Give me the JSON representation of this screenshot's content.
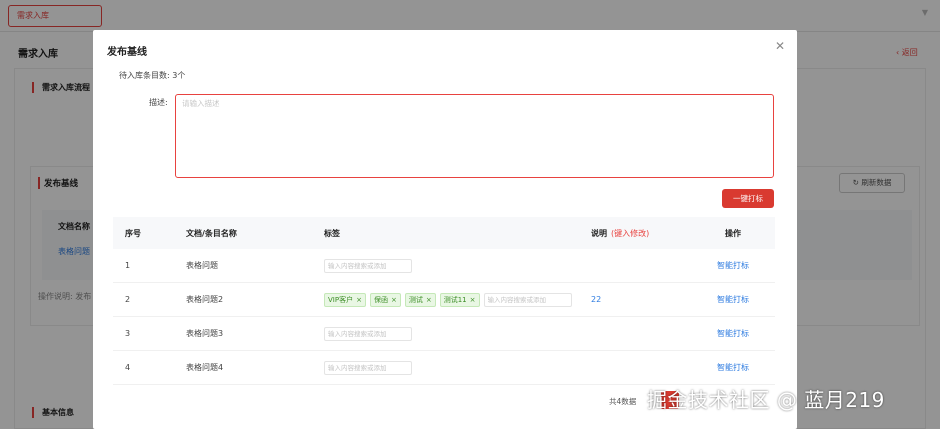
{
  "background": {
    "tab_label": "需求入库",
    "page_title": "需求入库",
    "back_label": "返回",
    "section_flow": "需求入库流程",
    "section_publish": "发布基线",
    "refresh_label": "刷新数据",
    "doc_header": "文档名称",
    "doc_link": "表格问题",
    "op_note": "操作说明: 发布",
    "section_basic": "基本信息"
  },
  "dialog": {
    "title": "发布基线",
    "pending_count": "待入库条目数: 3个",
    "desc_label": "描述:",
    "desc_placeholder": "请输入描述",
    "tag_all_label": "一键打标",
    "columns": {
      "index": "序号",
      "name": "文档/条目名称",
      "tags": "标签",
      "note": "说明",
      "note_hint": "(键入修改)",
      "action": "操作"
    },
    "tag_input_placeholder": "输入内容搜索或添加",
    "rows": [
      {
        "index": "1",
        "name": "表格问题",
        "tags": [],
        "note": "",
        "action": "智能打标"
      },
      {
        "index": "2",
        "name": "表格问题2",
        "tags": [
          "VIP客户",
          "保函",
          "测试",
          "测试11"
        ],
        "note": "22",
        "action": "智能打标"
      },
      {
        "index": "3",
        "name": "表格问题3",
        "tags": [],
        "note": "",
        "action": "智能打标"
      },
      {
        "index": "4",
        "name": "表格问题4",
        "tags": [],
        "note": "",
        "action": "智能打标"
      }
    ],
    "total": "共4数据",
    "page": "1"
  },
  "watermark": "掘金技术社区 @ 蓝月219",
  "colors": {
    "accent": "#d93a30",
    "link": "#2d7be0",
    "tag_bg": "#e9f7e4",
    "tag_text": "#3b8d25"
  }
}
